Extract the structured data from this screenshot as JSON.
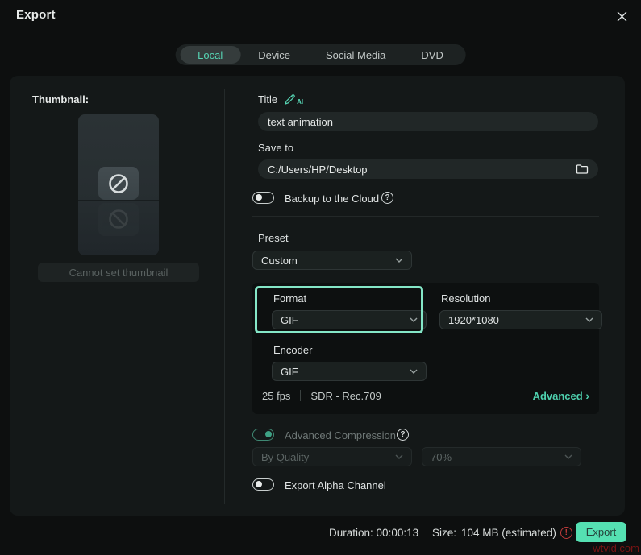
{
  "window": {
    "title": "Export",
    "close_glyph": "✕"
  },
  "tabs": [
    {
      "label": "Local",
      "active": true
    },
    {
      "label": "Device",
      "active": false
    },
    {
      "label": "Social Media",
      "active": false
    },
    {
      "label": "DVD",
      "active": false
    }
  ],
  "thumbnail": {
    "label": "Thumbnail:",
    "button_label": "Cannot set thumbnail"
  },
  "form": {
    "title_label": "Title",
    "title_ai_badge": "AI",
    "title_value": "text animation",
    "save_to_label": "Save to",
    "save_to_value": "C:/Users/HP/Desktop",
    "backup_label": "Backup to the Cloud",
    "backup_on": false,
    "preset_label": "Preset",
    "preset_value": "Custom",
    "format_label": "Format",
    "format_value": "GIF",
    "resolution_label": "Resolution",
    "resolution_value": "1920*1080",
    "encoder_label": "Encoder",
    "encoder_value": "GIF",
    "fps_value": "25 fps",
    "color_space_value": "SDR - Rec.709",
    "advanced_link": "Advanced",
    "advanced_arrow": "›",
    "advanced_compression_label": "Advanced Compression",
    "advanced_compression_on": true,
    "quality_mode_value": "By Quality",
    "quality_percent_value": "70%",
    "alpha_label": "Export Alpha Channel",
    "alpha_on": false
  },
  "footer": {
    "duration_label": "Duration:",
    "duration_value": "00:00:13",
    "size_label": "Size:",
    "size_value": "104 MB (estimated)",
    "export_button": "Export",
    "watermark": "wtvid.com"
  },
  "colors": {
    "accent": "#56d4b3",
    "highlight_border": "#84e6c7",
    "export_button_bg": "#55e0b2",
    "error": "#c23b3b",
    "panel_bg": "#141818",
    "window_bg": "#0d0f0f"
  }
}
